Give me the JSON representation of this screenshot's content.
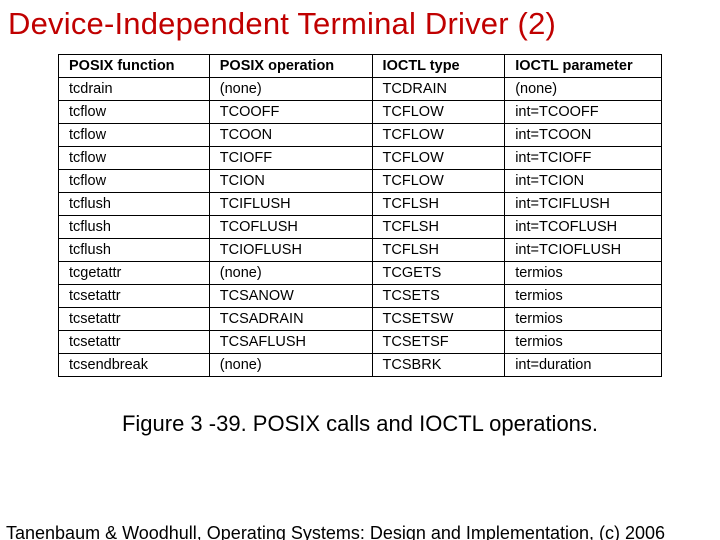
{
  "title": "Device-Independent Terminal Driver (2)",
  "headers": [
    "POSIX function",
    "POSIX operation",
    "IOCTL type",
    "IOCTL parameter"
  ],
  "rows": [
    [
      "tcdrain",
      "(none)",
      "TCDRAIN",
      "(none)"
    ],
    [
      "tcflow",
      "TCOOFF",
      "TCFLOW",
      "int=TCOOFF"
    ],
    [
      "tcflow",
      "TCOON",
      "TCFLOW",
      "int=TCOON"
    ],
    [
      "tcflow",
      "TCIOFF",
      "TCFLOW",
      "int=TCIOFF"
    ],
    [
      "tcflow",
      "TCION",
      "TCFLOW",
      "int=TCION"
    ],
    [
      "tcflush",
      "TCIFLUSH",
      "TCFLSH",
      "int=TCIFLUSH"
    ],
    [
      "tcflush",
      "TCOFLUSH",
      "TCFLSH",
      "int=TCOFLUSH"
    ],
    [
      "tcflush",
      "TCIOFLUSH",
      "TCFLSH",
      "int=TCIOFLUSH"
    ],
    [
      "tcgetattr",
      "(none)",
      "TCGETS",
      "termios"
    ],
    [
      "tcsetattr",
      "TCSANOW",
      "TCSETS",
      "termios"
    ],
    [
      "tcsetattr",
      "TCSADRAIN",
      "TCSETSW",
      "termios"
    ],
    [
      "tcsetattr",
      "TCSAFLUSH",
      "TCSETSF",
      "termios"
    ],
    [
      "tcsendbreak",
      "(none)",
      "TCSBRK",
      "int=duration"
    ]
  ],
  "caption": "Figure 3 -39. POSIX calls and IOCTL operations.",
  "footer": "Tanenbaum & Woodhull, Operating Systems: Design and Implementation, (c) 2006"
}
